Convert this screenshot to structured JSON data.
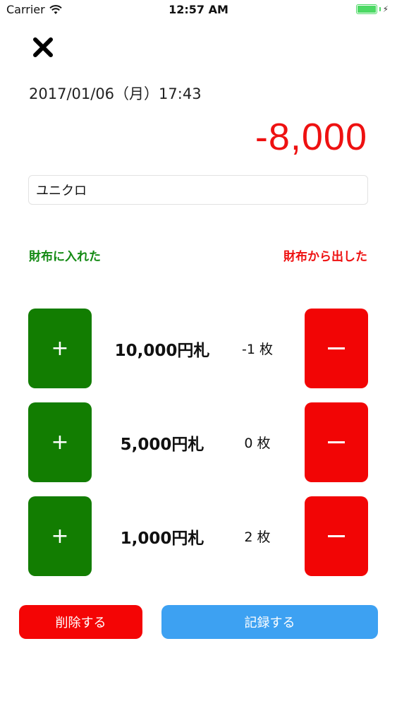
{
  "status_bar": {
    "carrier": "Carrier",
    "time": "12:57 AM"
  },
  "header": {
    "close_icon": "close-icon",
    "datetime": "2017/01/06（月）17:43",
    "amount": "-8,000"
  },
  "memo": {
    "value": "ユニクロ"
  },
  "labels": {
    "in": "財布に入れた",
    "out": "財布から出した"
  },
  "bills": [
    {
      "label": "10,000円札",
      "count": "-1 枚"
    },
    {
      "label": "5,000円札",
      "count": "0 枚"
    },
    {
      "label": "1,000円札",
      "count": "2 枚"
    }
  ],
  "buttons": {
    "plus": "+",
    "delete": "削除する",
    "record": "記録する"
  },
  "colors": {
    "green": "#127d01",
    "red": "#f20505",
    "blue": "#3da1f2",
    "amount_red": "#ee1111"
  }
}
